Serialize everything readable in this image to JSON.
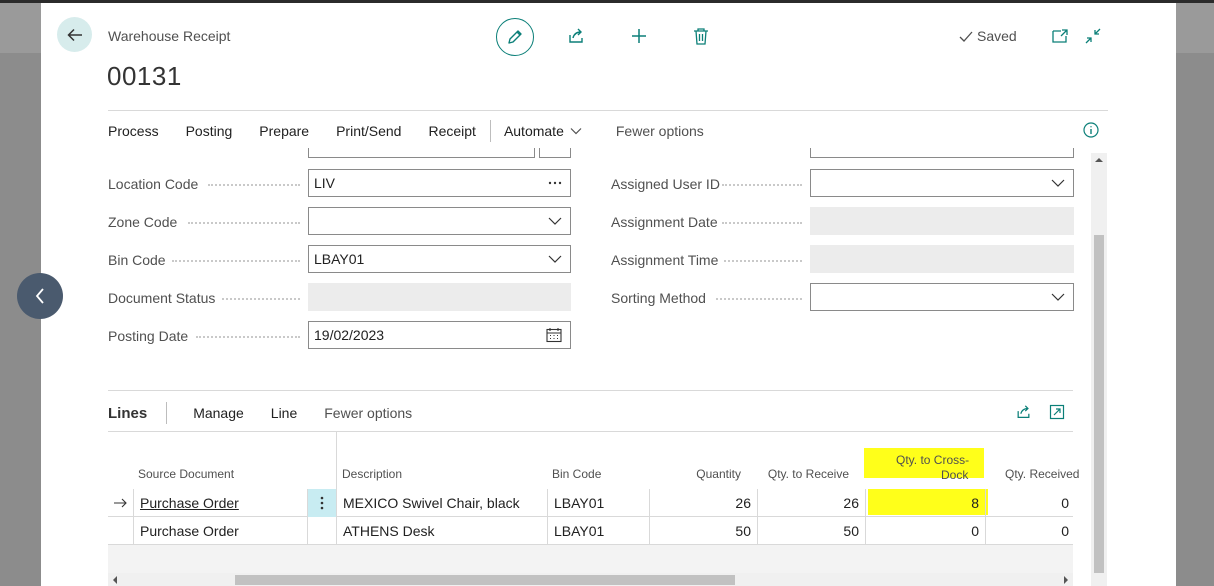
{
  "header": {
    "caption": "Warehouse Receipt",
    "record_no": "00131",
    "status": "Saved"
  },
  "actions": {
    "items": [
      "Process",
      "Posting",
      "Prepare",
      "Print/Send",
      "Receipt"
    ],
    "automate": "Automate",
    "fewer": "Fewer options"
  },
  "fields": {
    "location_code": {
      "label": "Location Code",
      "value": "LIV"
    },
    "zone_code": {
      "label": "Zone Code",
      "value": ""
    },
    "bin_code": {
      "label": "Bin Code",
      "value": "LBAY01"
    },
    "document_status": {
      "label": "Document Status",
      "value": ""
    },
    "posting_date": {
      "label": "Posting Date",
      "value": "19/02/2023"
    },
    "assigned_user_id": {
      "label": "Assigned User ID",
      "value": ""
    },
    "assignment_date": {
      "label": "Assignment Date",
      "value": ""
    },
    "assignment_time": {
      "label": "Assignment Time",
      "value": ""
    },
    "sorting_method": {
      "label": "Sorting Method",
      "value": ""
    }
  },
  "lines": {
    "title": "Lines",
    "actions": [
      "Manage",
      "Line"
    ],
    "fewer": "Fewer options",
    "columns": {
      "source_document": "Source Document",
      "description": "Description",
      "bin_code": "Bin Code",
      "quantity": "Quantity",
      "qty_to_receive": "Qty. to Receive",
      "qty_to_cross_dock_1": "Qty. to Cross-",
      "qty_to_cross_dock_2": "Dock",
      "qty_received": "Qty. Received"
    },
    "rows": [
      {
        "source_document": "Purchase Order",
        "description": "MEXICO Swivel Chair, black",
        "bin_code": "LBAY01",
        "quantity": "26",
        "qty_to_receive": "26",
        "qty_to_cross_dock": "8",
        "qty_received": "0"
      },
      {
        "source_document": "Purchase Order",
        "description": "ATHENS Desk",
        "bin_code": "LBAY01",
        "quantity": "50",
        "qty_to_receive": "50",
        "qty_to_cross_dock": "0",
        "qty_received": "0"
      }
    ]
  },
  "icons": {
    "back": "back-arrow-icon",
    "edit": "pencil-icon",
    "share": "share-icon",
    "new": "plus-icon",
    "delete": "trash-icon",
    "open_new_window": "open-in-new-window-icon",
    "collapse": "collapse-icon",
    "info": "info-icon",
    "prev": "chevron-left-icon"
  },
  "colors": {
    "accent": "#0b7f78",
    "highlight": "#ffff1a",
    "selected_cell": "#c8ecf2"
  }
}
